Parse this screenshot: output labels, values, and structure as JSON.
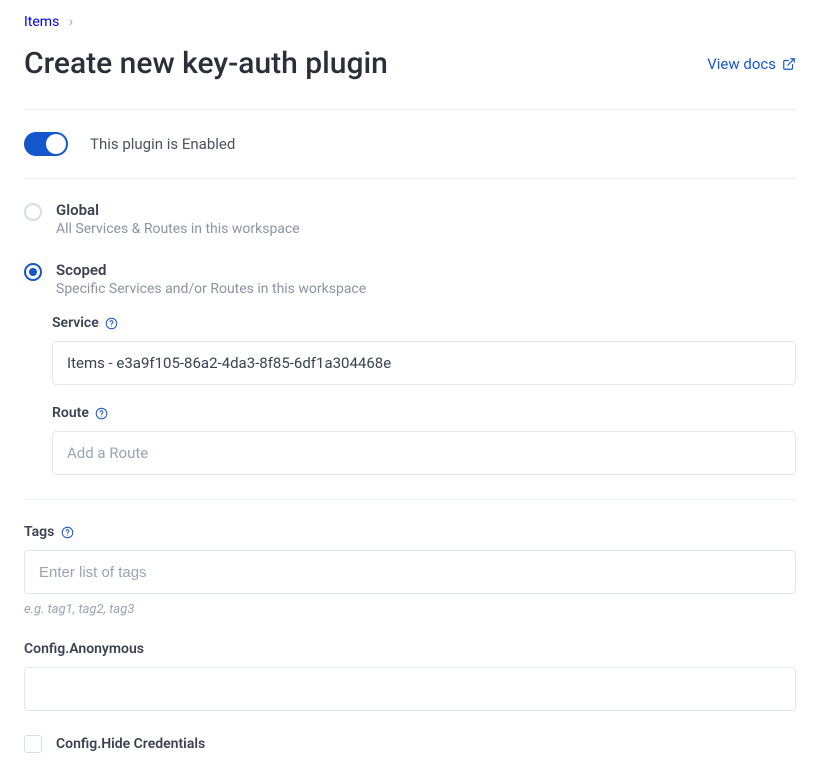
{
  "breadcrumb": {
    "item": "Items",
    "sep": "›"
  },
  "header": {
    "title": "Create new key-auth plugin",
    "view_docs": "View docs"
  },
  "enable": {
    "label": "This plugin is Enabled",
    "on": true
  },
  "scope": {
    "global": {
      "title": "Global",
      "desc": "All Services & Routes in this workspace",
      "selected": false
    },
    "scoped": {
      "title": "Scoped",
      "desc": "Specific Services and/or Routes in this workspace",
      "selected": true
    }
  },
  "service": {
    "label": "Service",
    "value": "Items - e3a9f105-86a2-4da3-8f85-6df1a304468e"
  },
  "route": {
    "label": "Route",
    "placeholder": "Add a Route",
    "value": ""
  },
  "tags": {
    "label": "Tags",
    "placeholder": "Enter list of tags",
    "hint": "e.g. tag1, tag2, tag3",
    "value": ""
  },
  "config_anonymous": {
    "label": "Config.Anonymous",
    "value": ""
  },
  "config_hide_credentials": {
    "label": "Config.Hide Credentials",
    "checked": false
  }
}
